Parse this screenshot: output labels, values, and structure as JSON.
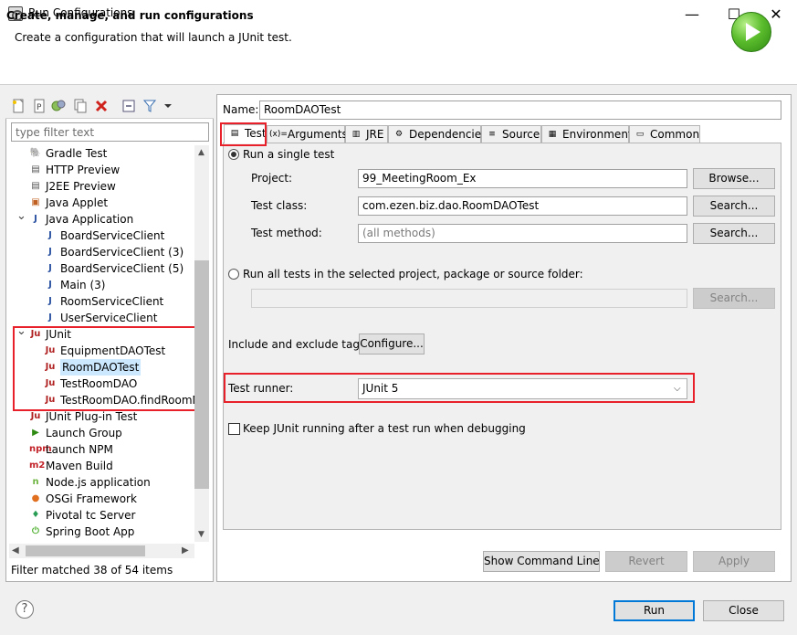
{
  "window": {
    "title": "Run Configurations",
    "minimize": "—",
    "maximize": "☐",
    "close": "✕"
  },
  "header": {
    "title": "Create, manage, and run configurations",
    "description": "Create a configuration that will launch a JUnit test."
  },
  "left": {
    "filter_placeholder": "type filter text",
    "tree": [
      {
        "label": "Gradle Test",
        "icon": "gradle-icon",
        "icon_glyph": "🐘",
        "color": "#1ba0b5"
      },
      {
        "label": "HTTP Preview",
        "icon": "http-preview-icon",
        "icon_glyph": "▤",
        "color": "#555"
      },
      {
        "label": "J2EE Preview",
        "icon": "j2ee-preview-icon",
        "icon_glyph": "▤",
        "color": "#555"
      },
      {
        "label": "Java Applet",
        "icon": "applet-icon",
        "icon_glyph": "▣",
        "color": "#c06020"
      },
      {
        "label": "Java Application",
        "icon": "java-app-icon",
        "icon_glyph": "J",
        "color": "#2850a0"
      },
      {
        "label": "BoardServiceClient",
        "icon": "java-app-icon",
        "icon_glyph": "J",
        "color": "#2850a0"
      },
      {
        "label": "BoardServiceClient (3)",
        "icon": "java-app-icon",
        "icon_glyph": "J",
        "color": "#2850a0"
      },
      {
        "label": "BoardServiceClient (5)",
        "icon": "java-app-icon",
        "icon_glyph": "J",
        "color": "#2850a0"
      },
      {
        "label": "Main (3)",
        "icon": "java-app-icon",
        "icon_glyph": "J",
        "color": "#2850a0"
      },
      {
        "label": "RoomServiceClient",
        "icon": "java-app-icon",
        "icon_glyph": "J",
        "color": "#2850a0"
      },
      {
        "label": "UserServiceClient",
        "icon": "java-app-icon",
        "icon_glyph": "J",
        "color": "#2850a0"
      },
      {
        "label": "JUnit",
        "icon": "junit-icon",
        "icon_glyph": "Ju",
        "color": "#b02020"
      },
      {
        "label": "EquipmentDAOTest",
        "icon": "junit-icon",
        "icon_glyph": "Ju",
        "color": "#b02020"
      },
      {
        "label": "RoomDAOTest",
        "icon": "junit-icon",
        "icon_glyph": "Ju",
        "color": "#b02020"
      },
      {
        "label": "TestRoomDAO",
        "icon": "junit-icon",
        "icon_glyph": "Ju",
        "color": "#b02020"
      },
      {
        "label": "TestRoomDAO.findRoomN",
        "icon": "junit-icon",
        "icon_glyph": "Ju",
        "color": "#b02020"
      },
      {
        "label": "JUnit Plug-in Test",
        "icon": "junit-plugin-icon",
        "icon_glyph": "Ju",
        "color": "#b02020"
      },
      {
        "label": "Launch Group",
        "icon": "launch-group-icon",
        "icon_glyph": "▶",
        "color": "#2e8a12"
      },
      {
        "label": "Launch NPM",
        "icon": "npm-icon",
        "icon_glyph": "npm",
        "color": "#c12127"
      },
      {
        "label": "Maven Build",
        "icon": "maven-icon",
        "icon_glyph": "m2",
        "color": "#c12127"
      },
      {
        "label": "Node.js application",
        "icon": "nodejs-icon",
        "icon_glyph": "n",
        "color": "#6cb33f"
      },
      {
        "label": "OSGi Framework",
        "icon": "osgi-icon",
        "icon_glyph": "●",
        "color": "#e07020"
      },
      {
        "label": "Pivotal tc Server",
        "icon": "pivotal-icon",
        "icon_glyph": "♦",
        "color": "#2a9d55"
      },
      {
        "label": "Spring Boot App",
        "icon": "spring-boot-icon",
        "icon_glyph": "⏻",
        "color": "#4caf2c"
      }
    ],
    "filter_status": "Filter matched 38 of 54 items"
  },
  "right": {
    "name_label": "Name:",
    "name_value": "RoomDAOTest",
    "tabs": [
      {
        "label": "Test",
        "icon": "test-tab-icon",
        "icon_glyph": "▤"
      },
      {
        "label": "Arguments",
        "icon": "arguments-tab-icon",
        "icon_glyph": "(x)="
      },
      {
        "label": "JRE",
        "icon": "jre-tab-icon",
        "icon_glyph": "▥"
      },
      {
        "label": "Dependencies",
        "icon": "dependencies-tab-icon",
        "icon_glyph": "⚙"
      },
      {
        "label": "Source",
        "icon": "source-tab-icon",
        "icon_glyph": "≡"
      },
      {
        "label": "Environment",
        "icon": "environment-tab-icon",
        "icon_glyph": "▦"
      },
      {
        "label": "Common",
        "icon": "common-tab-icon",
        "icon_glyph": "▭"
      }
    ],
    "single_test_label": "Run a single test",
    "project_label": "Project:",
    "project_value": "99_MeetingRoom_Ex",
    "browse_label": "Browse...",
    "test_class_label": "Test class:",
    "test_class_value": "com.ezen.biz.dao.RoomDAOTest",
    "search_label": "Search...",
    "test_method_label": "Test method:",
    "test_method_placeholder": "(all methods)",
    "all_tests_label": "Run all tests in the selected project, package or source folder:",
    "tags_label": "Include and exclude tags:",
    "configure_label": "Configure...",
    "runner_label": "Test runner:",
    "runner_value": "JUnit 5",
    "keep_running_label": "Keep JUnit running after a test run when debugging",
    "show_cmd_label": "Show Command Line",
    "revert_label": "Revert",
    "apply_label": "Apply"
  },
  "footer": {
    "help": "?",
    "run_label": "Run",
    "close_label": "Close"
  }
}
